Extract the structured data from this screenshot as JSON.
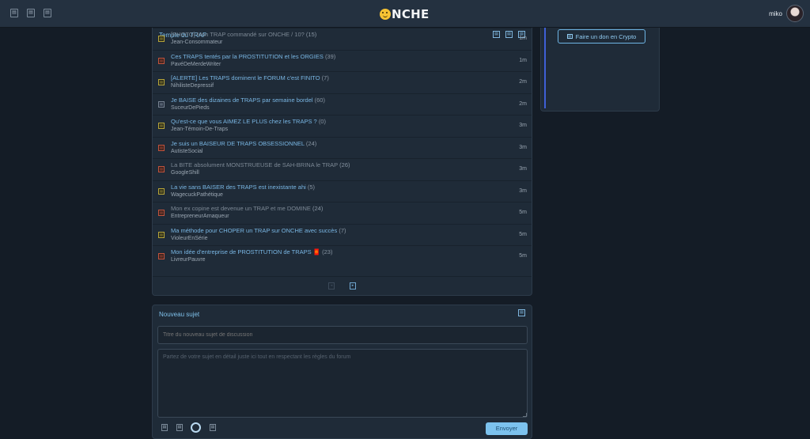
{
  "topbar": {
    "left_icons": [
      "menu-icon",
      "forum-icon",
      "list-icon"
    ],
    "logo_text": "NCHE",
    "username": "miko"
  },
  "topics_panel": {
    "title": "Temple du TRAP",
    "header_icons": [
      "refresh-icon",
      "settings-icon",
      "options-icon"
    ],
    "topics": [
      {
        "title": "[PHOTO] Mon TRAP commandé sur ONCHE / 10?",
        "count": "(15)",
        "author": "Jean-Consommateur",
        "time": "1m",
        "icon": "yellow",
        "dim": true
      },
      {
        "title": "Ces TRAPS tentés par la PROSTITUTION et les ORGIES",
        "count": "(39)",
        "author": "PavéDeMerdeWriter",
        "time": "1m",
        "icon": "red",
        "dim": false
      },
      {
        "title": "[ALERTE] Les TRAPS dominent le FORUM c'est FINITO",
        "count": "(7)",
        "author": "NihilisteDepressif",
        "time": "2m",
        "icon": "yellow",
        "dim": false
      },
      {
        "title": "Je BAISE des dizaines de TRAPS par semaine bordel",
        "count": "(60)",
        "author": "SuceurDePieds",
        "time": "2m",
        "icon": "gray",
        "dim": false
      },
      {
        "title": "Qu'est-ce que vous AIMEZ LE PLUS chez les TRAPS ?",
        "count": "(0)",
        "author": "Jean-Témoin-De-Traps",
        "time": "3m",
        "icon": "yellow",
        "dim": false
      },
      {
        "title": "Je suis un BAISEUR DE TRAPS OBSESSIONNEL",
        "count": "(24)",
        "author": "AutisteSocial",
        "time": "3m",
        "icon": "red",
        "dim": false
      },
      {
        "title": "La BITE absolument MONSTRUEUSE de SAH-BRINA le TRAP",
        "count": "(26)",
        "author": "GoogleShill",
        "time": "3m",
        "icon": "red",
        "dim": true
      },
      {
        "title": "La vie sans BAISER des TRAPS est inexistante ahi",
        "count": "(5)",
        "author": "WagecuckPathétique",
        "time": "3m",
        "icon": "yellow",
        "dim": false
      },
      {
        "title": "Mon ex copine est devenue un TRAP et me DOMINE",
        "count": "(24)",
        "author": "EntrepreneurArnaqueur",
        "time": "5m",
        "icon": "red",
        "dim": true
      },
      {
        "title": "Ma méthode pour CHOPER un TRAP sur ONCHE avec succès",
        "count": "(7)",
        "author": "VioleurEnSérie",
        "time": "5m",
        "icon": "yellow",
        "dim": false
      },
      {
        "title": "Mon idée d'entreprise de PROSTITUTION de TRAPS 🧧",
        "count": "(23)",
        "author": "LivreurPauvre",
        "time": "5m",
        "icon": "red",
        "dim": false
      }
    ]
  },
  "sidebar": {
    "donate_label": "Faire un don en Crypto"
  },
  "new_topic": {
    "title": "Nouveau sujet",
    "title_placeholder": "Titre du nouveau sujet de discussion",
    "body_placeholder": "Partez de votre sujet en détail juste ici tout en respectant les règles du forum",
    "send_label": "Envoyer"
  },
  "colors": {
    "background": "#141c26",
    "panel": "#1f2b38",
    "link": "#79b6e3",
    "accent": "#7cc2ee"
  }
}
